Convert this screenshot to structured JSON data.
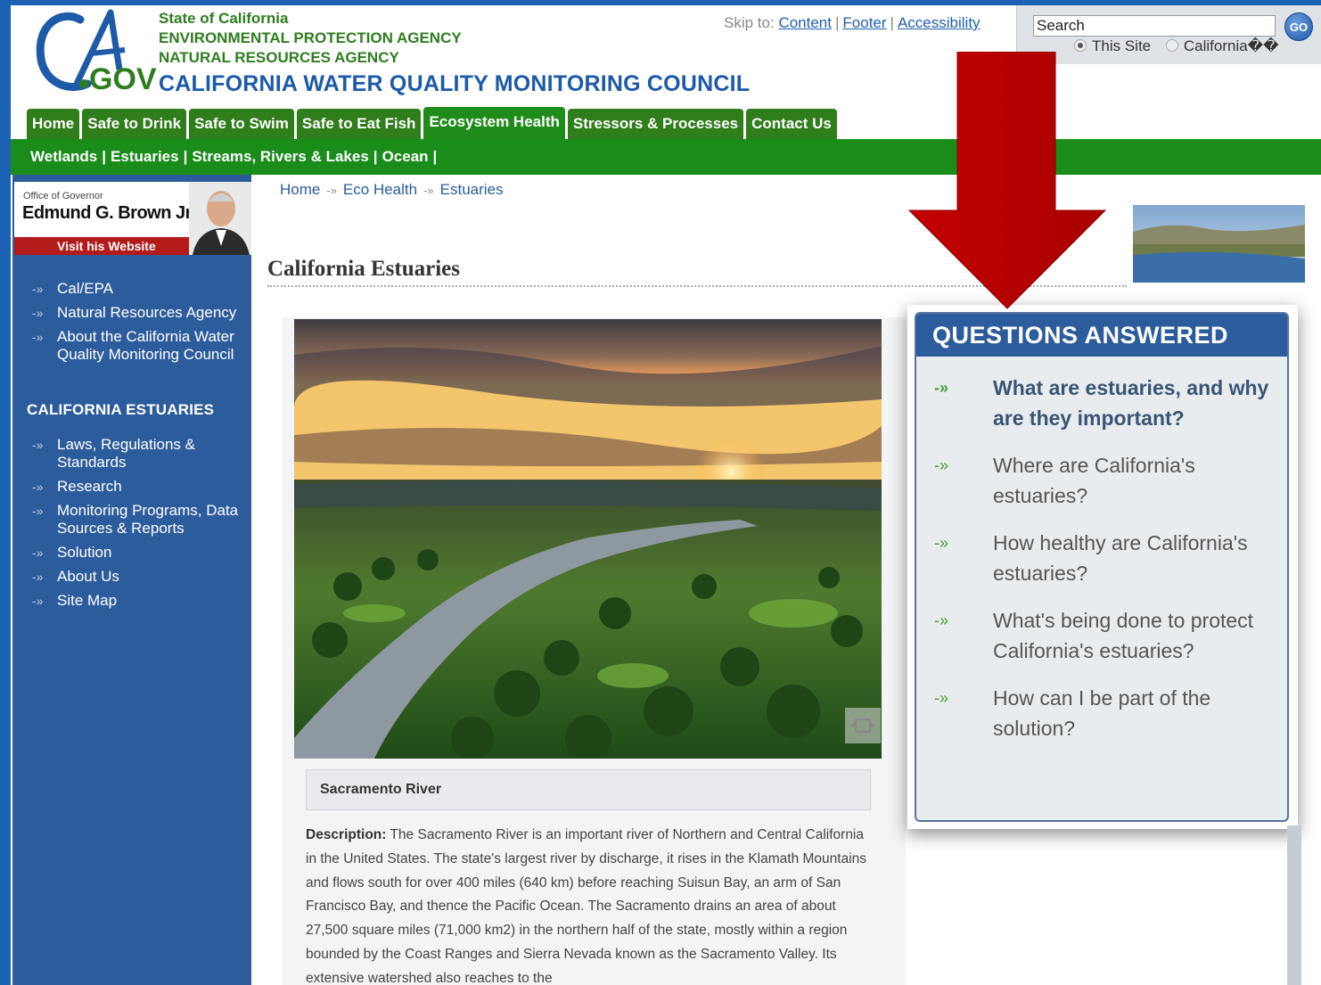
{
  "header": {
    "agency_lines": [
      "State of California",
      "ENVIRONMENTAL PROTECTION AGENCY",
      "NATURAL RESOURCES AGENCY"
    ],
    "council_title": "CALIFORNIA WATER QUALITY MONITORING COUNCIL",
    "logo_text": "CA.GOV",
    "skip": {
      "label": "Skip to:",
      "content": "Content",
      "footer": "Footer",
      "accessibility": "Accessibility",
      "sep": "|"
    }
  },
  "search": {
    "value": "Search",
    "go_label": "GO",
    "option_site": "This Site",
    "option_ca": "California��"
  },
  "tabs": [
    {
      "label": "Home"
    },
    {
      "label": "Safe to Drink"
    },
    {
      "label": "Safe to Swim"
    },
    {
      "label": "Safe to Eat Fish"
    },
    {
      "label": "Ecosystem Health"
    },
    {
      "label": "Stressors & Processes"
    },
    {
      "label": "Contact Us"
    }
  ],
  "subnav": [
    "Wetlands",
    "Estuaries",
    "Streams, Rivers & Lakes",
    "Ocean"
  ],
  "subnav_sep": "|",
  "governor": {
    "office": "Office of Governor",
    "name": "Edmund G. Brown Jr.",
    "visit": "Visit his Website"
  },
  "sidebar_top": [
    "Cal/EPA",
    "Natural Resources Agency",
    "About the California Water Quality Monitoring Council"
  ],
  "sidebar_heading": "CALIFORNIA ESTUARIES",
  "sidebar_bottom": [
    "Laws, Regulations & Standards",
    "Research",
    "Monitoring Programs, Data Sources & Reports",
    "Solution",
    "About Us",
    "Site Map"
  ],
  "breadcrumb": [
    "Home",
    "Eco Health",
    "Estuaries"
  ],
  "page_title": "California Estuaries",
  "caption": "Sacramento River",
  "description": {
    "label": "Description:",
    "text": " The Sacramento River is an important river of Northern and Central California in the United States. The state's largest river by discharge, it rises in the Klamath Mountains and flows south for over 400 miles (640 km) before reaching Suisun Bay, an arm of San Francisco Bay, and thence the Pacific Ocean. The Sacramento drains an area of about 27,500 square miles (71,000 km2) in the northern half of the state, mostly within a region bounded by the Coast Ranges and Sierra Nevada known as the Sacramento Valley. Its extensive watershed also reaches to the"
  },
  "questions": {
    "heading": "QUESTIONS ANSWERED",
    "items": [
      "What are estuaries, and why are they important?",
      "Where are California's estuaries?",
      "How healthy are California's estuaries?",
      "What's being done to protect California's estuaries?",
      "How can I be part of the solution?"
    ]
  },
  "icon_glyphs": {
    "chevron": "-»"
  },
  "colors": {
    "brand_blue": "#1d5aa8",
    "brand_green": "#2e7d1f",
    "nav_green": "#1a8c1a",
    "sidebar_blue": "#2d5c9c",
    "arrow_red": "#c00000"
  }
}
